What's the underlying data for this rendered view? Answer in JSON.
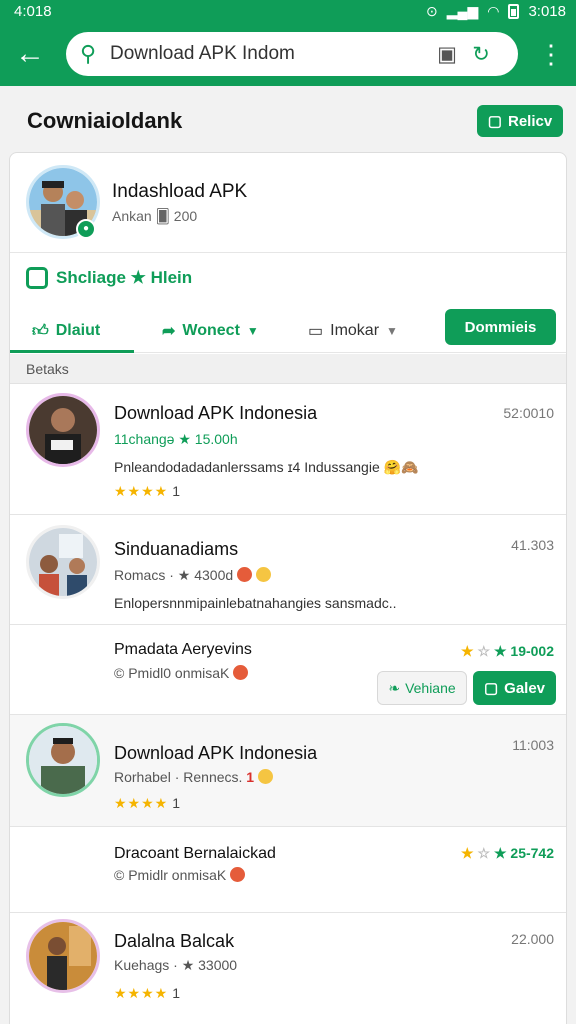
{
  "status_bar": {
    "time": "4:018",
    "clock_right": "3:018"
  },
  "search": {
    "query": "Download APK Indom"
  },
  "page": {
    "title": "Cowniaioldank",
    "refresh_label": "Relicv"
  },
  "profile": {
    "name": "Indashload APK",
    "meta": "Ankan 🂠 200",
    "tagline": "Shcliage ★ Hlein"
  },
  "tabs": {
    "tab1": "Dlaiut",
    "tab2": "Wonect",
    "tab3": "Imokar",
    "downloads": "Dommieis"
  },
  "section": {
    "label": "Betaks"
  },
  "items": [
    {
      "title": "Download APK Indonesia",
      "sub": "11changə ★ 15.00h",
      "desc": "Pnleandodadadanlerssams ɪ4 Indussangie 🤗🙈",
      "stars": "★★★★",
      "count": "1",
      "time": "52:0010"
    },
    {
      "title": "Sinduanadiams",
      "sub": "Romacs · ★ 4300d",
      "desc": "Enlopersnnmipainlebatnahangies sansmadc..",
      "time": "41.303"
    },
    {
      "title": "Download APK Indonesia",
      "sub": "Rorhabel · Rennecs.",
      "sub_num": "1",
      "stars": "★★★★",
      "count": "1",
      "time": "11:003"
    },
    {
      "title": "Dalalna Balcak",
      "sub": "Kuehags · ★ 33000",
      "stars": "★★★★",
      "count": "1",
      "time": "22.000"
    }
  ],
  "replies": [
    {
      "title": "Pmadata Aeryevins",
      "sub": "Pmidl0 onmisaK",
      "rating": "19-002",
      "btn1": "Vehiane",
      "btn2": "Galev"
    },
    {
      "title": "Dracoant Bernalaickad",
      "sub": "Pmidlr onmisaK",
      "rating": "25-742"
    }
  ]
}
